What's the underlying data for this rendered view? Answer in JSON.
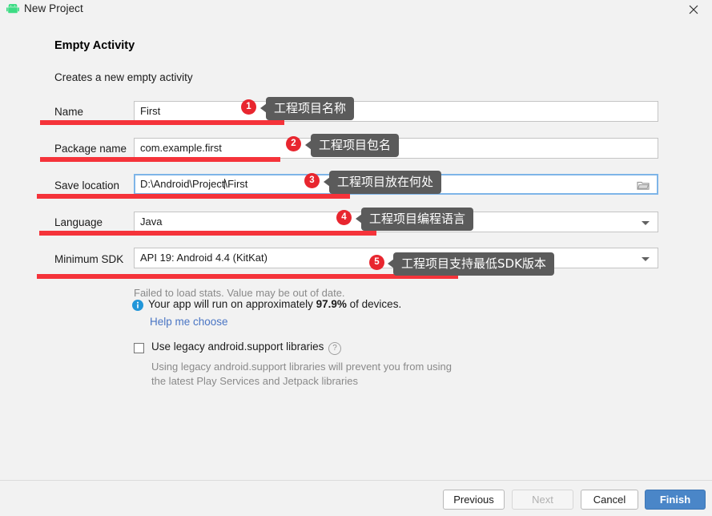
{
  "window": {
    "title": "New Project",
    "icon": "android-robot-icon",
    "close_icon": "close-icon"
  },
  "dialog": {
    "heading": "Empty Activity",
    "subheading": "Creates a new empty activity"
  },
  "form": {
    "fields": [
      {
        "label": "Name",
        "value": "First",
        "type": "text",
        "focused": false
      },
      {
        "label": "Package name",
        "value": "com.example.first",
        "type": "text",
        "focused": false
      },
      {
        "label": "Save location",
        "value": "D:\\Android\\Project\\First",
        "type": "path",
        "focused": true
      },
      {
        "label": "Language",
        "value": "Java",
        "type": "select",
        "focused": false
      },
      {
        "label": "Minimum SDK",
        "value": "API 19: Android 4.4 (KitKat)",
        "type": "select",
        "focused": false
      }
    ]
  },
  "annotations": {
    "underline_color": "#f5333a",
    "callout_bg": "#5b5b5b",
    "badge_bg": "#e8262f",
    "items": [
      {
        "number": "1",
        "text": "工程项目名称"
      },
      {
        "number": "2",
        "text": "工程项目包名"
      },
      {
        "number": "3",
        "text": "工程项目放在何处"
      },
      {
        "number": "4",
        "text": "工程项目编程语言"
      },
      {
        "number": "5",
        "text": "工程项目支持最低SDK版本"
      }
    ]
  },
  "stats": {
    "warning": "Failed to load stats. Value may be out of date.",
    "info_prefix": "Your app will run on approximately ",
    "info_percent": "97.9%",
    "info_suffix": " of devices.",
    "help_link": "Help me choose",
    "info_icon": "info-icon",
    "info_icon_color": "#2196d9"
  },
  "legacy": {
    "checkbox_label": "Use legacy android.support libraries",
    "checked": false,
    "help_icon": "question-mark-icon",
    "description_line1": "Using legacy android.support libraries will prevent you from using",
    "description_line2": "the latest Play Services and Jetpack libraries"
  },
  "footer": {
    "previous": "Previous",
    "next": "Next",
    "cancel": "Cancel",
    "finish": "Finish",
    "next_disabled": true,
    "finish_color": "#4a86c8"
  }
}
